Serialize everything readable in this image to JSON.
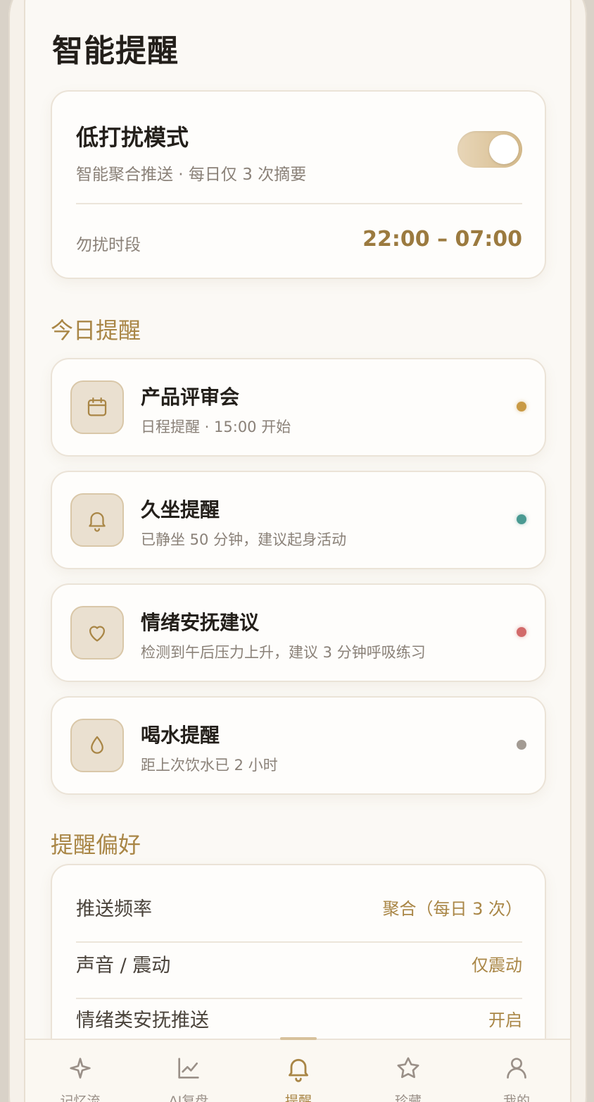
{
  "page": {
    "title": "智能提醒"
  },
  "dnd": {
    "title": "低打扰模式",
    "subtitle": "智能聚合推送 · 每日仅 3 次摘要",
    "enabled": true,
    "quiet_label": "勿扰时段",
    "quiet_value": "22:00 – 07:00"
  },
  "today": {
    "section_title": "今日提醒",
    "items": [
      {
        "title": "产品评审会",
        "subtitle": "日程提醒 · 15:00 开始",
        "icon": "calendar-icon",
        "dot_color": "#c99a45"
      },
      {
        "title": "久坐提醒",
        "subtitle": "已静坐 50 分钟，建议起身活动",
        "icon": "bell-icon",
        "dot_color": "#4a9a92"
      },
      {
        "title": "情绪安抚建议",
        "subtitle": "检测到午后压力上升，建议 3 分钟呼吸练习",
        "icon": "heart-icon",
        "dot_color": "#d26a6a"
      },
      {
        "title": "喝水提醒",
        "subtitle": "距上次饮水已 2 小时",
        "icon": "water-drop-icon",
        "dot_color": "#a39b93"
      }
    ]
  },
  "preferences": {
    "section_title": "提醒偏好",
    "rows": [
      {
        "label": "推送频率",
        "value": "聚合（每日 3 次）"
      },
      {
        "label": "声音 / 震动",
        "value": "仅震动"
      },
      {
        "label": "情绪类安抚推送",
        "value": "开启"
      }
    ]
  },
  "tabbar": {
    "active_index": 2,
    "items": [
      {
        "label": "记忆流",
        "icon": "sparkle-icon"
      },
      {
        "label": "AI复盘",
        "icon": "chart-line-icon"
      },
      {
        "label": "提醒",
        "icon": "bell-icon"
      },
      {
        "label": "珍藏",
        "icon": "star-icon"
      },
      {
        "label": "我的",
        "icon": "user-icon"
      }
    ]
  },
  "colors": {
    "accent": "#a98646",
    "accent_dark": "#9b7a3f",
    "card_border": "#ebe3d7"
  }
}
